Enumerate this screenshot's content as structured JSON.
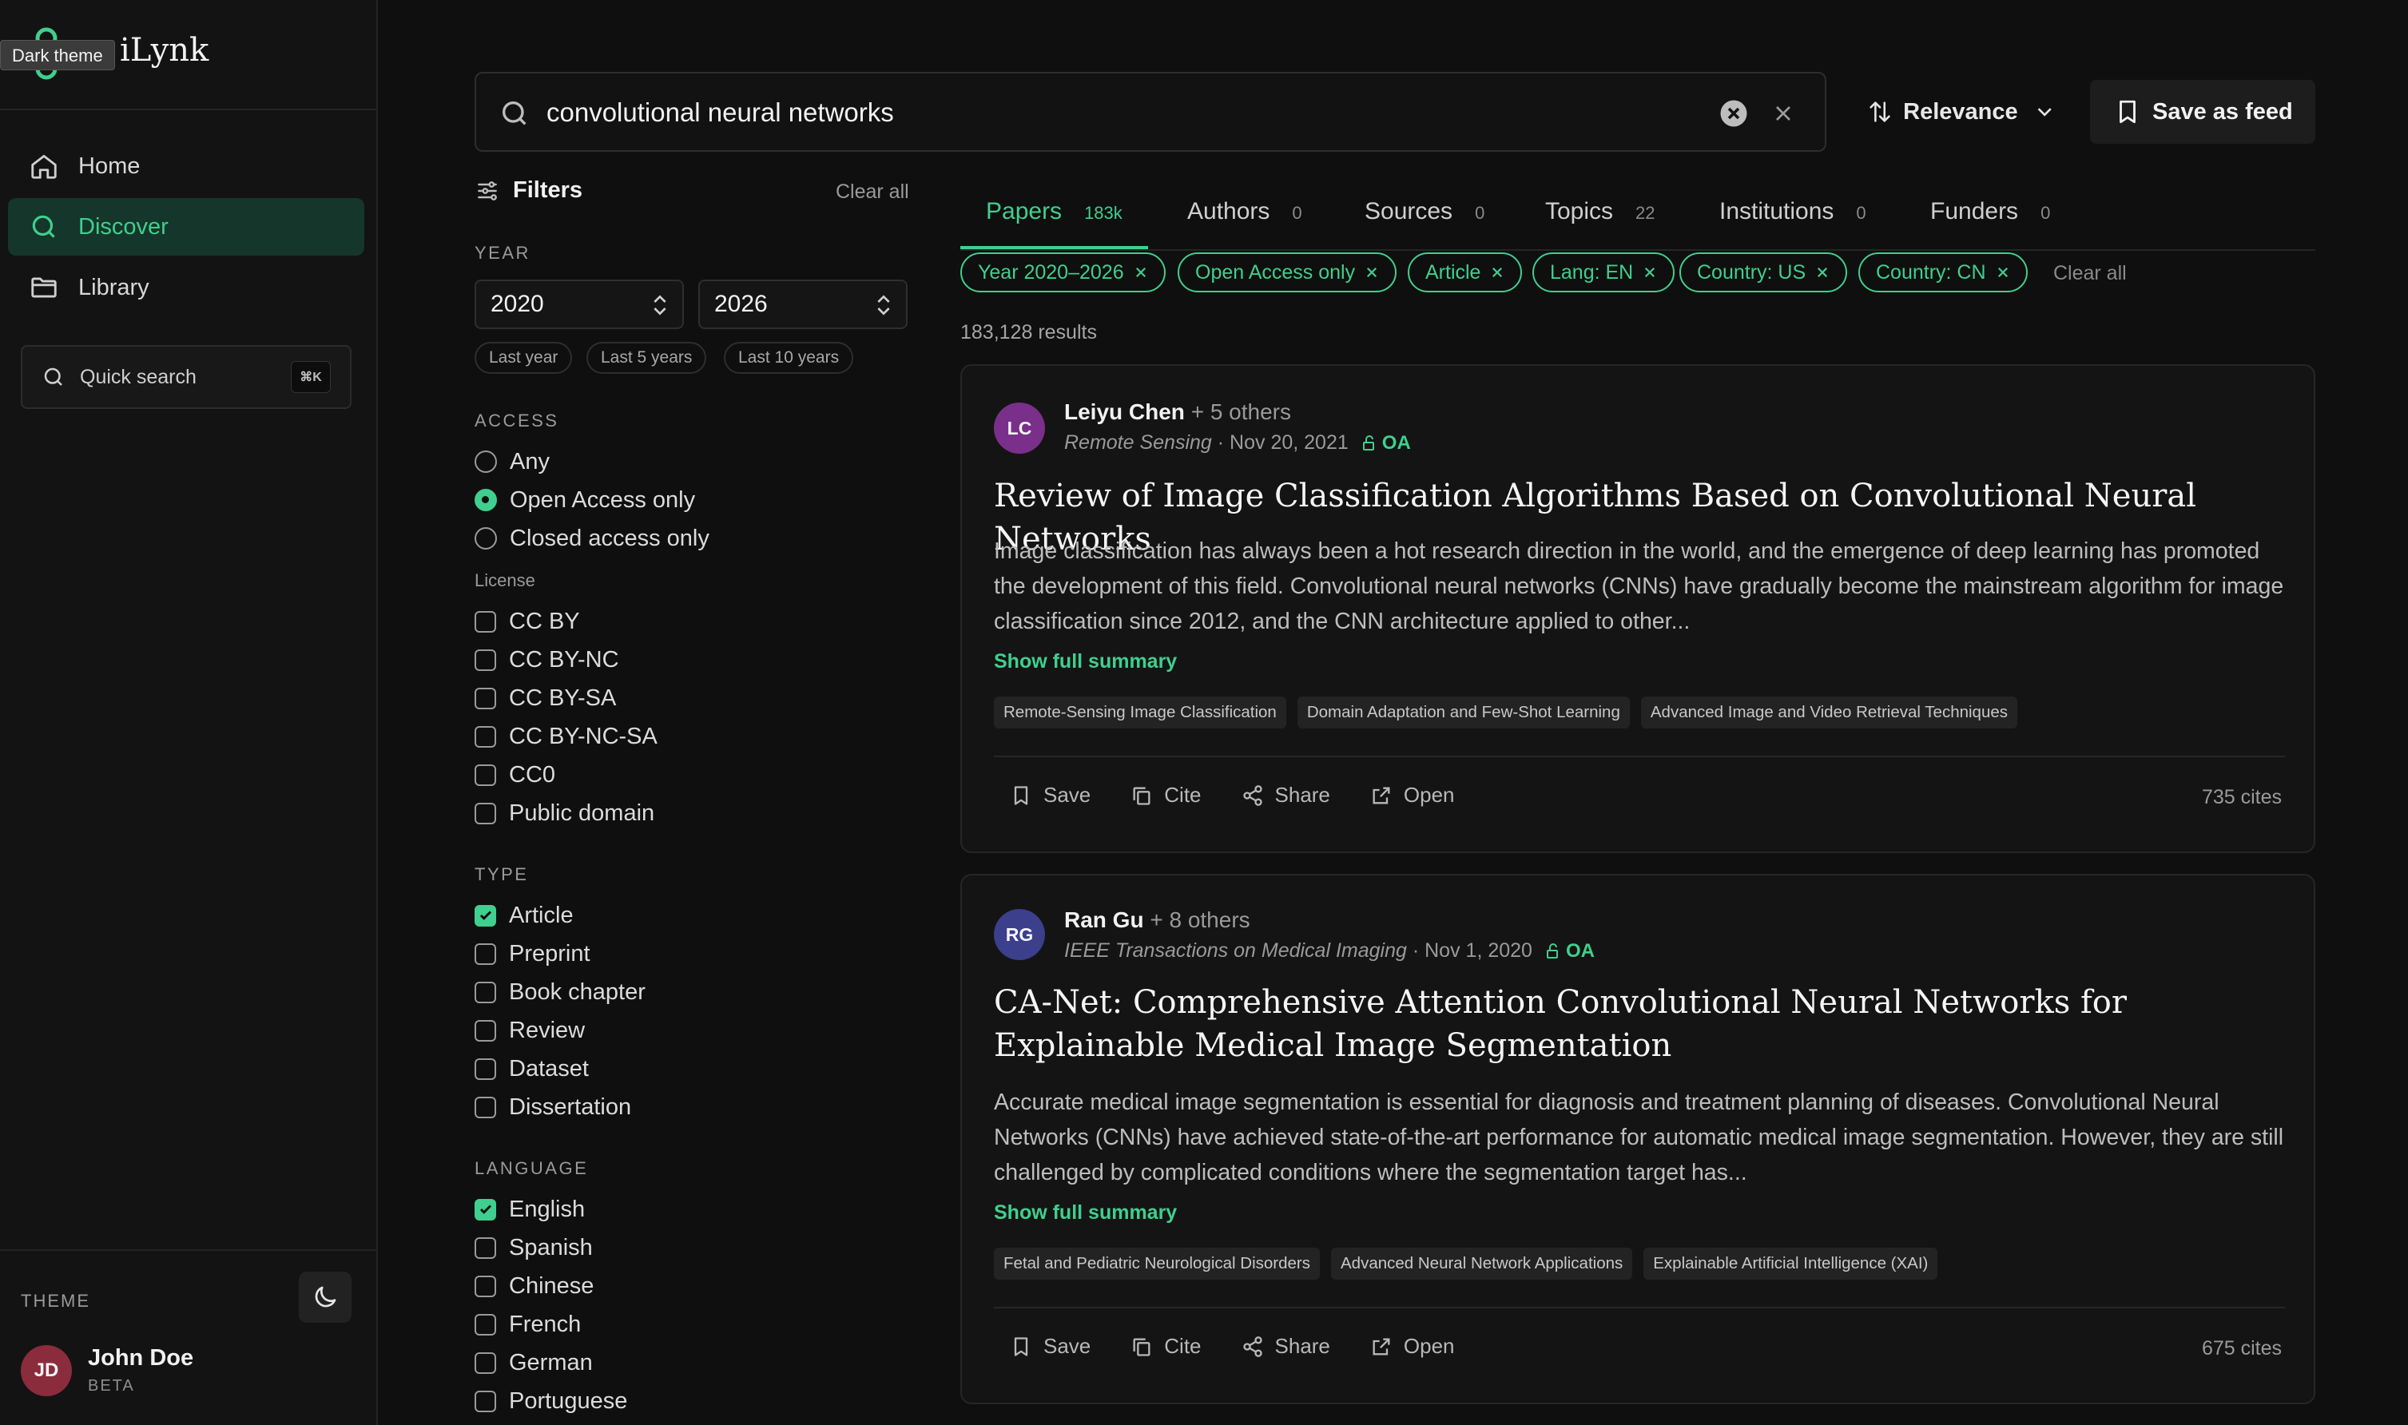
{
  "app": {
    "name_visible": "iLynk",
    "tooltip": "Dark theme"
  },
  "sidebar": {
    "nav": [
      {
        "label": "Home",
        "icon": "home-icon"
      },
      {
        "label": "Discover",
        "icon": "search-icon",
        "active": true
      },
      {
        "label": "Library",
        "icon": "folder-icon"
      }
    ],
    "quick_search": {
      "label": "Quick search",
      "shortcut": "⌘K"
    },
    "theme_label": "THEME",
    "user": {
      "initials": "JD",
      "name": "John Doe",
      "badge": "BETA"
    }
  },
  "search": {
    "query": "convolutional neural networks"
  },
  "toolbar": {
    "sort_label": "Relevance",
    "save_feed_label": "Save as feed"
  },
  "filters": {
    "title": "Filters",
    "clear_label": "Clear all",
    "year": {
      "label": "YEAR",
      "from": "2020",
      "to": "2026",
      "quick": [
        "Last year",
        "Last 5 years",
        "Last 10 years"
      ]
    },
    "access": {
      "label": "ACCESS",
      "options": [
        {
          "label": "Any",
          "selected": false
        },
        {
          "label": "Open Access only",
          "selected": true
        },
        {
          "label": "Closed access only",
          "selected": false
        }
      ]
    },
    "license": {
      "label": "License",
      "options": [
        "CC BY",
        "CC BY-NC",
        "CC BY-SA",
        "CC BY-NC-SA",
        "CC0",
        "Public domain"
      ]
    },
    "type": {
      "label": "TYPE",
      "options": [
        {
          "label": "Article",
          "checked": true
        },
        {
          "label": "Preprint",
          "checked": false
        },
        {
          "label": "Book chapter",
          "checked": false
        },
        {
          "label": "Review",
          "checked": false
        },
        {
          "label": "Dataset",
          "checked": false
        },
        {
          "label": "Dissertation",
          "checked": false
        }
      ]
    },
    "language": {
      "label": "LANGUAGE",
      "options": [
        {
          "label": "English",
          "checked": true
        },
        {
          "label": "Spanish",
          "checked": false
        },
        {
          "label": "Chinese",
          "checked": false
        },
        {
          "label": "French",
          "checked": false
        },
        {
          "label": "German",
          "checked": false
        },
        {
          "label": "Portuguese",
          "checked": false
        }
      ]
    }
  },
  "tabs": [
    {
      "label": "Papers",
      "count": "183k",
      "active": true
    },
    {
      "label": "Authors",
      "count": "0"
    },
    {
      "label": "Sources",
      "count": "0"
    },
    {
      "label": "Topics",
      "count": "22"
    },
    {
      "label": "Institutions",
      "count": "0"
    },
    {
      "label": "Funders",
      "count": "0"
    }
  ],
  "active_filters": [
    "Year 2020–2026",
    "Open Access only",
    "Article",
    "Lang: EN",
    "Country: US",
    "Country: CN"
  ],
  "active_filters_clear": "Clear all",
  "results_count": "183,128 results",
  "colors": {
    "accent": "#3fcf8e",
    "background": "#0f0f0f",
    "card": "#141414"
  },
  "results": [
    {
      "initials": "LC",
      "avatar_color": "#7a2f8a",
      "author": "Leiyu Chen",
      "others": "+ 5 others",
      "venue": "Remote Sensing",
      "date": "· Nov 20, 2021",
      "oa": "OA",
      "title": "Review of Image Classification Algorithms Based on Convolutional Neural Networks",
      "abstract": "Image classification has always been a hot research direction in the world, and the emergence of deep learning has promoted the development of this field. Convolutional neural networks (CNNs) have gradually become the mainstream algorithm for image classification since 2012, and the CNN architecture applied to other...",
      "show_full": "Show full summary",
      "topics": [
        "Remote-Sensing Image Classification",
        "Domain Adaptation and Few-Shot Learning",
        "Advanced Image and Video Retrieval Techniques"
      ],
      "actions": [
        "Save",
        "Cite",
        "Share",
        "Open"
      ],
      "cites": "735 cites"
    },
    {
      "initials": "RG",
      "avatar_color": "#3b3f8c",
      "author": "Ran Gu",
      "others": "+ 8 others",
      "venue": "IEEE Transactions on Medical Imaging",
      "date": "· Nov 1, 2020",
      "oa": "OA",
      "title": "CA-Net: Comprehensive Attention Convolutional Neural Networks for Explainable Medical Image Segmentation",
      "abstract": "Accurate medical image segmentation is essential for diagnosis and treatment planning of diseases. Convolutional Neural Networks (CNNs) have achieved state-of-the-art performance for automatic medical image segmentation. However, they are still challenged by complicated conditions where the segmentation target has...",
      "show_full": "Show full summary",
      "topics": [
        "Fetal and Pediatric Neurological Disorders",
        "Advanced Neural Network Applications",
        "Explainable Artificial Intelligence (XAI)"
      ],
      "actions": [
        "Save",
        "Cite",
        "Share",
        "Open"
      ],
      "cites": "675 cites"
    }
  ]
}
